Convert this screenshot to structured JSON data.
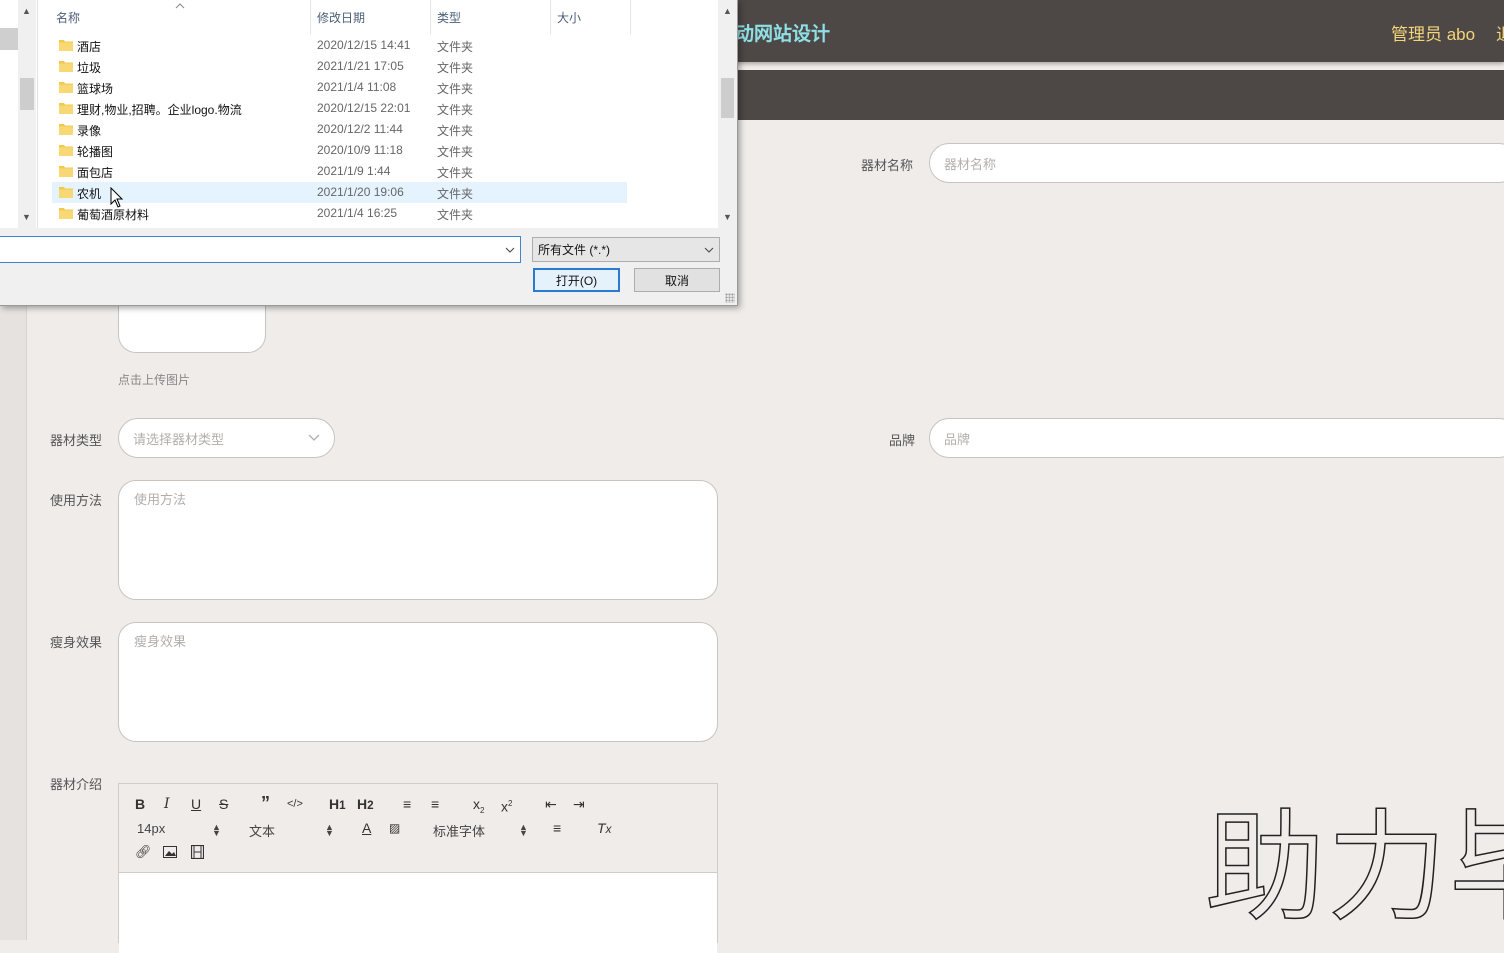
{
  "site": {
    "title_fragment": "动网站设计",
    "admin_label": "管理员 abo",
    "admin_extra": "退"
  },
  "form": {
    "name_label": "器材名称",
    "name_placeholder": "器材名称",
    "upload_hint": "点击上传图片",
    "type_label": "器材类型",
    "type_placeholder": "请选择器材类型",
    "brand_label": "品牌",
    "brand_placeholder": "品牌",
    "usage_label": "使用方法",
    "usage_placeholder": "使用方法",
    "effect_label": "瘦身效果",
    "effect_placeholder": "瘦身效果",
    "intro_label": "器材介绍"
  },
  "editor": {
    "font_size": "14px",
    "paragraph": "文本",
    "font_family": "标准字体",
    "toolbar_icons": [
      "bold-icon",
      "italic-icon",
      "underline-icon",
      "strikethrough-icon",
      "quote-icon",
      "code-icon",
      "h1-icon",
      "h2-icon",
      "ordered-list-icon",
      "bullet-list-icon",
      "subscript-icon",
      "superscript-icon",
      "outdent-icon",
      "indent-icon",
      "font-color-icon",
      "background-color-icon",
      "align-icon",
      "clear-format-icon",
      "link-icon",
      "image-icon",
      "video-icon"
    ]
  },
  "watermark": "助力毕",
  "dialog": {
    "columns": {
      "name": "名称",
      "date": "修改日期",
      "type": "类型",
      "size": "大小"
    },
    "files": [
      {
        "name": "酒店",
        "date": "2020/12/15 14:41",
        "type": "文件夹"
      },
      {
        "name": "垃圾",
        "date": "2021/1/21 17:05",
        "type": "文件夹"
      },
      {
        "name": "篮球场",
        "date": "2021/1/4 11:08",
        "type": "文件夹"
      },
      {
        "name": "理财,物业,招聘。企业logo.物流",
        "date": "2020/12/15 22:01",
        "type": "文件夹"
      },
      {
        "name": "录像",
        "date": "2020/12/2 11:44",
        "type": "文件夹"
      },
      {
        "name": "轮播图",
        "date": "2020/10/9 11:18",
        "type": "文件夹"
      },
      {
        "name": "面包店",
        "date": "2021/1/9 1:44",
        "type": "文件夹"
      },
      {
        "name": "农机",
        "date": "2021/1/20 19:06",
        "type": "文件夹"
      },
      {
        "name": "葡萄酒原材料",
        "date": "2021/1/4 16:25",
        "type": "文件夹"
      }
    ],
    "selected_index": 7,
    "filename_value": "",
    "filetype_filter": "所有文件 (*.*)",
    "open_label": "打开(O)",
    "cancel_label": "取消"
  },
  "colors": {
    "header_bg": "#4d4846",
    "title_accent": "#8fe0e6",
    "admin_accent": "#f3d57a",
    "page_bg": "#f0ecea",
    "dialog_selection": "#e5f3ff"
  }
}
